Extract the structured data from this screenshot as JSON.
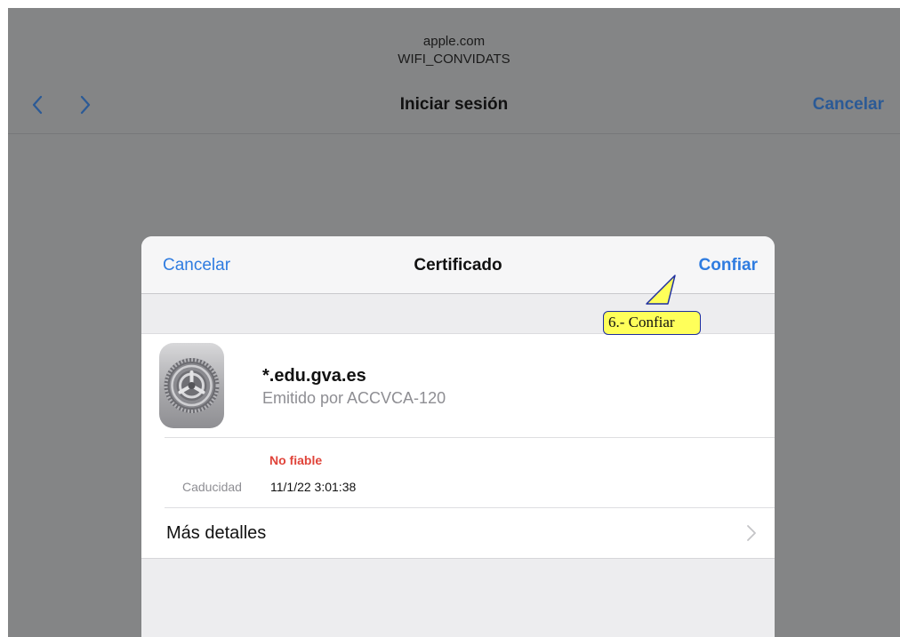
{
  "browser": {
    "domain": "apple.com",
    "ssid": "WIFI_CONVIDATS",
    "title": "Iniciar sesión",
    "cancel_label": "Cancelar",
    "back_icon": "chevron-left-icon",
    "forward_icon": "chevron-right-icon"
  },
  "sheet": {
    "cancel_label": "Cancelar",
    "title": "Certificado",
    "trust_label": "Confiar",
    "certificate": {
      "icon": "settings-gear-icon",
      "name": "*.edu.gva.es",
      "issuer": "Emitido por ACCVCA-120",
      "status": "No fiable",
      "expiry_label": "Caducidad",
      "expiry_value": "11/1/22 3:01:38"
    },
    "more_details_label": "Más detalles"
  },
  "annotation": {
    "text": "6.- Confiar"
  },
  "colors": {
    "accent": "#2f7ce0",
    "warning": "#e0443a",
    "callout_fill": "#ffff5a",
    "callout_border": "#1f2fa0",
    "overlay": "#848586"
  }
}
